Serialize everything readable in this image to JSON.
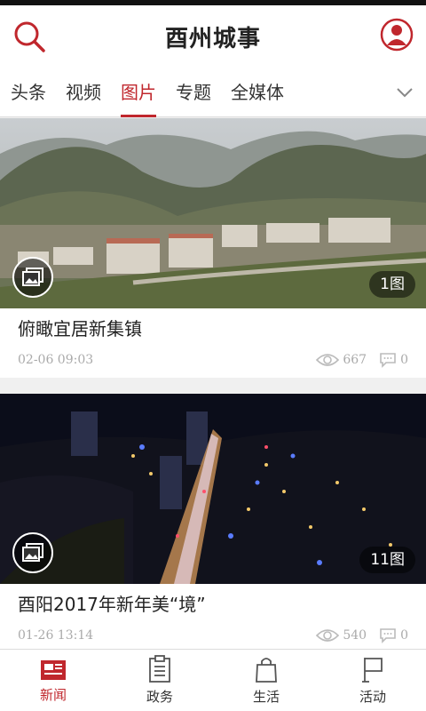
{
  "header": {
    "title": "酉州城事"
  },
  "tabs": [
    {
      "label": "头条",
      "active": false
    },
    {
      "label": "视频",
      "active": false
    },
    {
      "label": "图片",
      "active": true
    },
    {
      "label": "专题",
      "active": false
    },
    {
      "label": "全媒体",
      "active": false
    }
  ],
  "cards": [
    {
      "title": "俯瞰宜居新集镇",
      "date": "02-06 09:03",
      "views": "667",
      "comments": "0",
      "photo_count": "1图"
    },
    {
      "title": "酉阳2017年新年美“境”",
      "date": "01-26 13:14",
      "views": "540",
      "comments": "0",
      "photo_count": "11图"
    }
  ],
  "bottom_nav": [
    {
      "label": "新闻",
      "icon": "newspaper-icon",
      "active": true
    },
    {
      "label": "政务",
      "icon": "clipboard-icon",
      "active": false
    },
    {
      "label": "生活",
      "icon": "shopping-bag-icon",
      "active": false
    },
    {
      "label": "活动",
      "icon": "flag-icon",
      "active": false
    }
  ],
  "colors": {
    "accent": "#c0272d"
  }
}
